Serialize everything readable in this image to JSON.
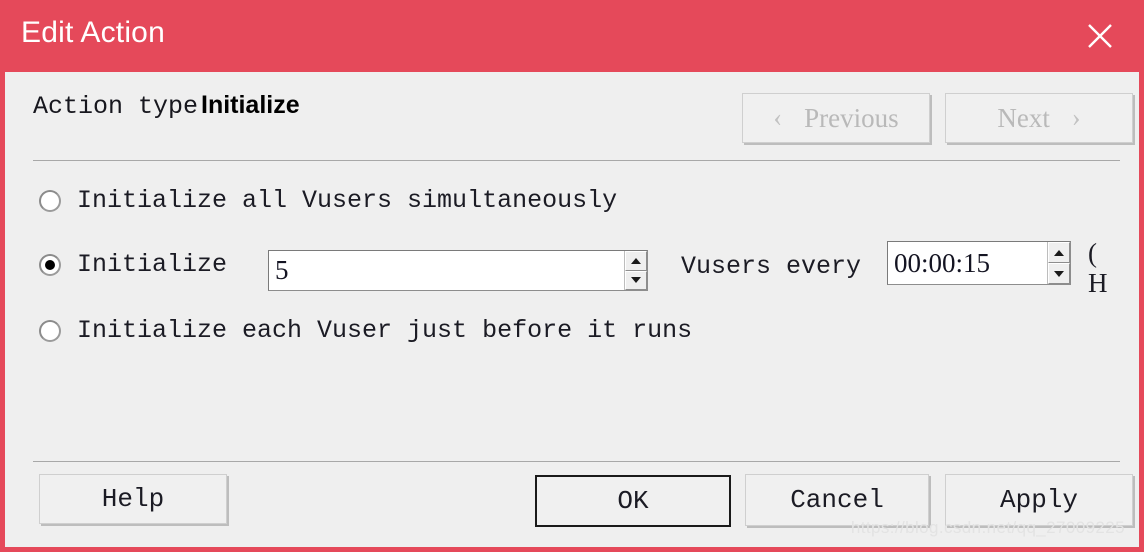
{
  "window": {
    "title": "Edit Action",
    "title_bar_color": "#e5495a",
    "body_color": "#efefef",
    "close_icon": "close-icon"
  },
  "header": {
    "action_type_label": "Action type",
    "action_type_value": "Initialize",
    "previous_label": "Previous",
    "previous_chevron": "‹",
    "previous_enabled": false,
    "next_label": "Next",
    "next_chevron": "›",
    "next_enabled": false
  },
  "options": {
    "all_simultaneously": {
      "label": "Initialize all Vusers simultaneously",
      "selected": false
    },
    "gradual": {
      "label": "Initialize",
      "selected": true,
      "count_value": "5",
      "middle_label": "Vusers every",
      "interval_value": "00:00:15",
      "clipped_suffix_line1": "(",
      "clipped_suffix_line2": "H"
    },
    "just_before_run": {
      "label": "Initialize each Vuser just before it runs",
      "selected": false
    }
  },
  "footer": {
    "help_label": "Help",
    "ok_label": "OK",
    "cancel_label": "Cancel",
    "apply_label": "Apply",
    "default_button": "OK"
  },
  "watermark": {
    "text": "https://blog.csdn.net/qq_27009225"
  }
}
